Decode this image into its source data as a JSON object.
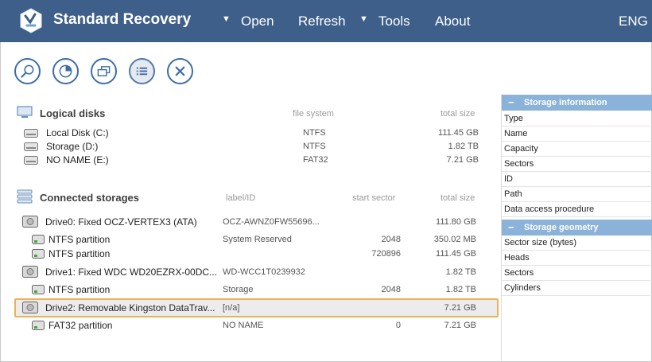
{
  "app": {
    "title": "Standard Recovery",
    "lang": "ENG"
  },
  "menu": {
    "open": "Open",
    "refresh": "Refresh",
    "tools": "Tools",
    "about": "About",
    "caret": "▼"
  },
  "colors": {
    "titlebar": "#3d5f8a",
    "accent": "#3d6da5",
    "selection_border": "#e8b258",
    "panel_header": "#8bb2d8"
  },
  "toolbar": {
    "buttons": [
      {
        "icon": "scan-icon"
      },
      {
        "icon": "disk-chart-icon"
      },
      {
        "icon": "disk-image-icon"
      },
      {
        "icon": "list-view-icon"
      },
      {
        "icon": "close-icon"
      }
    ]
  },
  "logical": {
    "title": "Logical disks",
    "col_fs": "file system",
    "col_size": "total size",
    "rows": [
      {
        "name": "Local Disk (C:)",
        "fs": "NTFS",
        "size": "111.45 GB"
      },
      {
        "name": "Storage (D:)",
        "fs": "NTFS",
        "size": "1.82 TB"
      },
      {
        "name": "NO NAME (E:)",
        "fs": "FAT32",
        "size": "7.21 GB"
      }
    ]
  },
  "storages": {
    "title": "Connected storages",
    "col_label": "label/ID",
    "col_sector": "start sector",
    "col_size": "total size",
    "rows": [
      {
        "name": "Drive0: Fixed OCZ-VERTEX3 (ATA)",
        "label": "OCZ-AWNZ0FW55696...",
        "sector": "",
        "size": "111.80 GB"
      },
      {
        "name": "NTFS partition",
        "label": "System Reserved",
        "sector": "2048",
        "size": "350.02 MB"
      },
      {
        "name": "NTFS partition",
        "label": "",
        "sector": "720896",
        "size": "111.45 GB"
      },
      {
        "name": "Drive1: Fixed WDC WD20EZRX-00DC...",
        "label": "WD-WCC1T0239932",
        "sector": "",
        "size": "1.82 TB"
      },
      {
        "name": "NTFS partition",
        "label": "Storage",
        "sector": "2048",
        "size": "1.82 TB"
      },
      {
        "name": "Drive2: Removable Kingston DataTrav...",
        "label": "[n/a]",
        "sector": "",
        "size": "7.21 GB"
      },
      {
        "name": "FAT32 partition",
        "label": "NO NAME",
        "sector": "0",
        "size": "7.21 GB"
      }
    ]
  },
  "panel": {
    "info_title": "Storage information",
    "info_rows": [
      "Type",
      "Name",
      "Capacity",
      "Sectors",
      "ID",
      "Path",
      "Data access procedure"
    ],
    "geom_title": "Storage geometry",
    "geom_rows": [
      "Sector size (bytes)",
      "Heads",
      "Sectors",
      "Cylinders"
    ],
    "minus": "−"
  }
}
